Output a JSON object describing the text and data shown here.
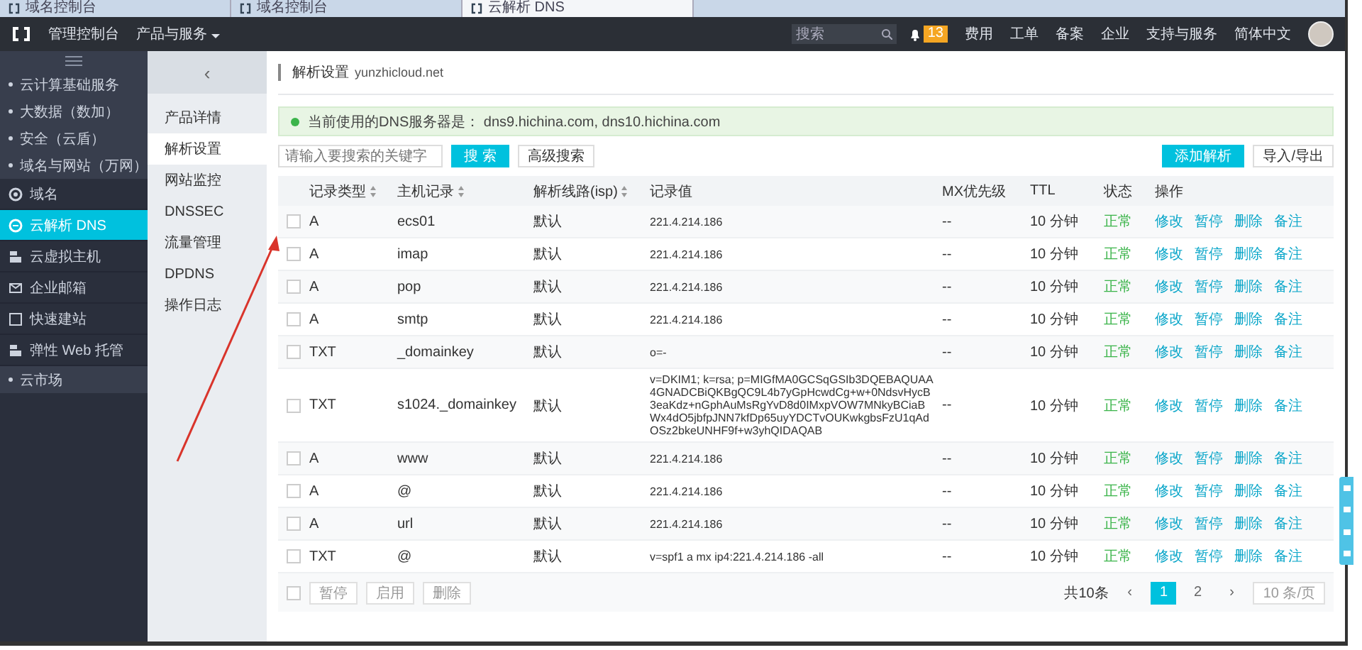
{
  "browser_tabs": [
    {
      "title": "域名控制台",
      "selected": false
    },
    {
      "title": "域名控制台",
      "selected": false
    },
    {
      "title": "云解析 DNS",
      "selected": true
    }
  ],
  "top_nav": {
    "console": "管理控制台",
    "products": "产品与服务",
    "search": {
      "placeholder": "搜索"
    },
    "badge": "13",
    "links": [
      "费用",
      "工单",
      "备案",
      "企业",
      "支持与服务",
      "简体中文"
    ]
  },
  "sidebar": {
    "groups": [
      "云计算基础服务",
      "大数据（数加）",
      "安全（云盾）",
      "域名与网站（万网）"
    ],
    "items": [
      {
        "label": "域名",
        "selected": false
      },
      {
        "label": "云解析 DNS",
        "selected": true
      },
      {
        "label": "云虚拟主机",
        "selected": false
      },
      {
        "label": "企业邮箱",
        "selected": false
      },
      {
        "label": "快速建站",
        "selected": false
      },
      {
        "label": "弹性 Web 托管",
        "selected": false
      }
    ],
    "footer_group": "云市场"
  },
  "sub_nav": {
    "back": "‹",
    "items": [
      {
        "label": "产品详情",
        "selected": false
      },
      {
        "label": "解析设置",
        "selected": true
      },
      {
        "label": "网站监控",
        "selected": false
      },
      {
        "label": "DNSSEC",
        "selected": false
      },
      {
        "label": "流量管理",
        "selected": false
      },
      {
        "label": "DPDNS",
        "selected": false
      },
      {
        "label": "操作日志",
        "selected": false
      }
    ]
  },
  "header": {
    "title": "解析设置",
    "domain": "yunzhicloud.net"
  },
  "alert": {
    "text": "当前使用的DNS服务器是： dns9.hichina.com, dns10.hichina.com"
  },
  "toolbar": {
    "search": {
      "placeholder": "请输入要搜索的关键字"
    },
    "search_button": "搜 索",
    "advanced": "高级搜索",
    "add_button": "添加解析",
    "import_export": "导入/导出"
  },
  "table": {
    "columns": [
      {
        "label": "记录类型",
        "sortable": true
      },
      {
        "label": "主机记录",
        "sortable": true
      },
      {
        "label": "解析线路(isp)",
        "sortable": true
      },
      {
        "label": "记录值",
        "sortable": false
      },
      {
        "label": "MX优先级",
        "sortable": false
      },
      {
        "label": "TTL",
        "sortable": false
      },
      {
        "label": "状态",
        "sortable": false
      },
      {
        "label": "操作",
        "sortable": false
      }
    ],
    "rows": [
      {
        "checked": false,
        "type": "A",
        "host": "ecs01",
        "line": "默认",
        "value": "221.4.214.186",
        "mx": "--",
        "ttl": "10 分钟",
        "status": "正常",
        "actions": [
          "修改",
          "暂停",
          "删除",
          "备注"
        ]
      },
      {
        "checked": false,
        "type": "A",
        "host": "imap",
        "line": "默认",
        "value": "221.4.214.186",
        "mx": "--",
        "ttl": "10 分钟",
        "status": "正常",
        "actions": [
          "修改",
          "暂停",
          "删除",
          "备注"
        ]
      },
      {
        "checked": false,
        "type": "A",
        "host": "pop",
        "line": "默认",
        "value": "221.4.214.186",
        "mx": "--",
        "ttl": "10 分钟",
        "status": "正常",
        "actions": [
          "修改",
          "暂停",
          "删除",
          "备注"
        ]
      },
      {
        "checked": false,
        "type": "A",
        "host": "smtp",
        "line": "默认",
        "value": "221.4.214.186",
        "mx": "--",
        "ttl": "10 分钟",
        "status": "正常",
        "actions": [
          "修改",
          "暂停",
          "删除",
          "备注"
        ]
      },
      {
        "checked": false,
        "type": "TXT",
        "host": "_domainkey",
        "line": "默认",
        "value": "o=-",
        "mx": "--",
        "ttl": "10 分钟",
        "status": "正常",
        "actions": [
          "修改",
          "暂停",
          "删除",
          "备注"
        ]
      },
      {
        "checked": false,
        "type": "TXT",
        "host": "s1024._domainkey",
        "line": "默认",
        "value": "v=DKIM1; k=rsa; p=MIGfMA0GCSqGSIb3DQEBAQUAA4GNADCBiQKBgQC9L4b7yGpHcwdCg+w+0NdsvHycB3eaKdz+nGphAuMsRgYvD8d0IMxpVOW7MNkyBCiaBWx4dO5jbfpJNN7kfDp65uyYDCTvOUKwkgbsFzU1qAdOSz2bkeUNHF9f+w3yhQIDAQAB",
        "mx": "--",
        "ttl": "10 分钟",
        "status": "正常",
        "actions": [
          "修改",
          "暂停",
          "删除",
          "备注"
        ]
      },
      {
        "checked": false,
        "type": "A",
        "host": "www",
        "line": "默认",
        "value": "221.4.214.186",
        "mx": "--",
        "ttl": "10 分钟",
        "status": "正常",
        "actions": [
          "修改",
          "暂停",
          "删除",
          "备注"
        ]
      },
      {
        "checked": false,
        "type": "A",
        "host": "@",
        "line": "默认",
        "value": "221.4.214.186",
        "mx": "--",
        "ttl": "10 分钟",
        "status": "正常",
        "actions": [
          "修改",
          "暂停",
          "删除",
          "备注"
        ]
      },
      {
        "checked": false,
        "type": "A",
        "host": "url",
        "line": "默认",
        "value": "221.4.214.186",
        "mx": "--",
        "ttl": "10 分钟",
        "status": "正常",
        "actions": [
          "修改",
          "暂停",
          "删除",
          "备注"
        ]
      },
      {
        "checked": false,
        "type": "TXT",
        "host": "@",
        "line": "默认",
        "value": "v=spf1 a mx ip4:221.4.214.186 -all",
        "mx": "--",
        "ttl": "10 分钟",
        "status": "正常",
        "actions": [
          "修改",
          "暂停",
          "删除",
          "备注"
        ]
      }
    ]
  },
  "footer": {
    "select_all": {
      "checked": false
    },
    "buttons": [
      "暂停",
      "启用",
      "删除"
    ],
    "total": "共10条",
    "prev": "‹",
    "pages": [
      {
        "label": "1",
        "selected": true
      },
      {
        "label": "2",
        "selected": false
      }
    ],
    "next": "›",
    "page_size": "10 条/页"
  }
}
